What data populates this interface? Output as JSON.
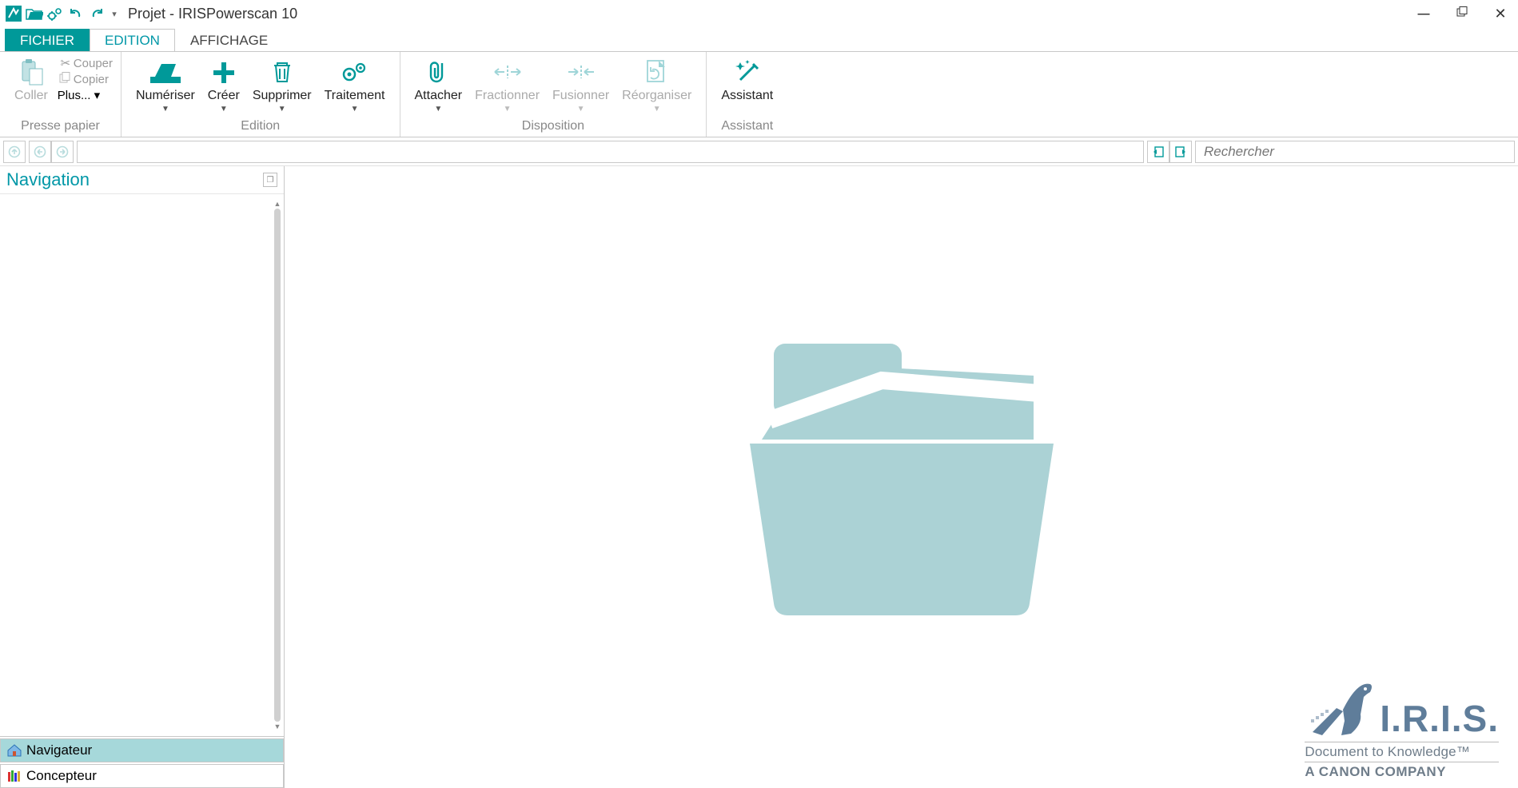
{
  "title": "Projet - IRISPowerscan 10",
  "ribbon_tabs": {
    "file": "FICHIER",
    "edition": "EDITION",
    "affichage": "AFFICHAGE"
  },
  "clipboard": {
    "paste": "Coller",
    "cut": "Couper",
    "copy": "Copier",
    "plus": "Plus... ▾",
    "group": "Presse papier"
  },
  "edition": {
    "scan": "Numériser",
    "create": "Créer",
    "delete": "Supprimer",
    "process": "Traitement",
    "group": "Edition"
  },
  "layout": {
    "attach": "Attacher",
    "split": "Fractionner",
    "merge": "Fusionner",
    "reorganize": "Réorganiser",
    "group": "Disposition"
  },
  "assistant": {
    "label": "Assistant",
    "group": "Assistant"
  },
  "search_placeholder": "Rechercher",
  "nav_panel": "Navigation",
  "bottom_tabs": {
    "navigator": "Navigateur",
    "designer": "Concepteur"
  },
  "brand": {
    "iris": "I.R.I.S.",
    "tagline": "Document to Knowledge™",
    "canon": "A CANON COMPANY"
  },
  "colors": {
    "accent": "#009999",
    "accent_light": "#a6d8da",
    "folder": "#abd2d5",
    "iris": "#5f7d9a"
  }
}
